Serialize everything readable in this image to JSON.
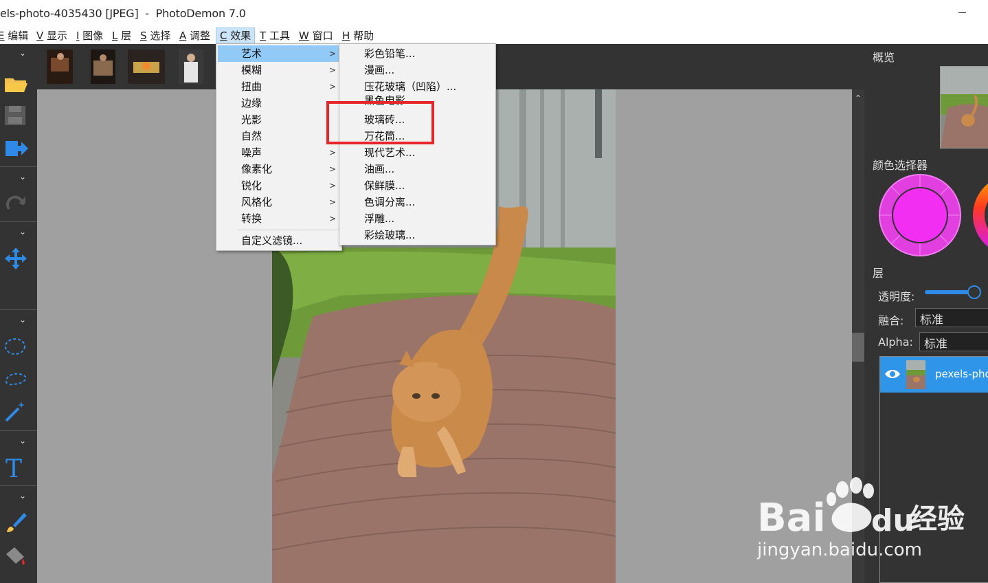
{
  "window": {
    "title": "els-photo-4035430 [JPEG]  -  PhotoDemon 7.0"
  },
  "menubar": {
    "items": [
      {
        "key": "E",
        "label": "编辑"
      },
      {
        "key": "V",
        "label": "显示"
      },
      {
        "key": "I",
        "label": "图像"
      },
      {
        "key": "L",
        "label": "层"
      },
      {
        "key": "S",
        "label": "选择"
      },
      {
        "key": "A",
        "label": "调整"
      },
      {
        "key": "C",
        "label": "效果"
      },
      {
        "key": "T",
        "label": "工具"
      },
      {
        "key": "W",
        "label": "窗口"
      },
      {
        "key": "H",
        "label": "帮助"
      }
    ]
  },
  "effects_menu": {
    "items": [
      "艺术",
      "模糊",
      "扭曲",
      "边缘",
      "光影",
      "自然",
      "噪声",
      "像素化",
      "锐化",
      "风格化",
      "转换"
    ],
    "selected": "艺术",
    "custom": "自定义滤镜..."
  },
  "artistic_submenu": {
    "items": [
      "彩色铅笔...",
      "漫画...",
      "压花玻璃（凹陷）...",
      "黑色电影...",
      "玻璃砖...",
      "万花筒...",
      "现代艺术...",
      "油画...",
      "保鲜膜...",
      "色调分离...",
      "浮雕...",
      "彩绘玻璃..."
    ]
  },
  "right_panel": {
    "overview_title": "概览",
    "color_picker_title": "颜色选择器",
    "layers_title": "层",
    "opacity_label": "透明度:",
    "opacity_value": 0.95,
    "blend_label": "融合:",
    "blend_value": "标准",
    "alpha_label": "Alpha:",
    "alpha_value": "标准",
    "layer_name": "pexels-phot"
  },
  "watermark": {
    "brand": "Bai",
    "brand2": "du",
    "cn": "经验",
    "url": "jingyan.baidu.com"
  },
  "colors": {
    "accent": "#2e8ae6",
    "menu_selected": "#91c9f7",
    "highlight_box": "#e5262b",
    "picker_magenta": "#f22ef2"
  }
}
